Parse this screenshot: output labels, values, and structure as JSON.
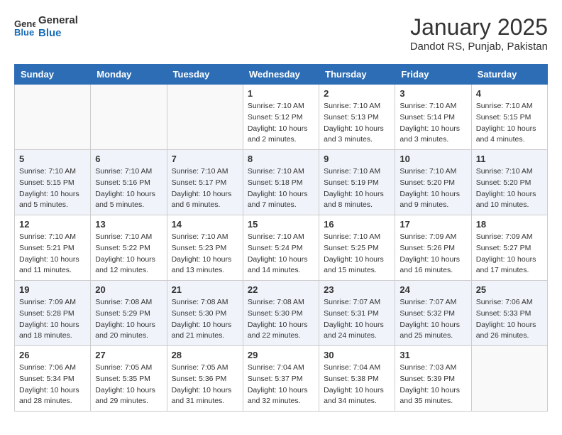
{
  "header": {
    "logo_line1": "General",
    "logo_line2": "Blue",
    "month_title": "January 2025",
    "subtitle": "Dandot RS, Punjab, Pakistan"
  },
  "weekdays": [
    "Sunday",
    "Monday",
    "Tuesday",
    "Wednesday",
    "Thursday",
    "Friday",
    "Saturday"
  ],
  "weeks": [
    [
      {
        "day": "",
        "sunrise": "",
        "sunset": "",
        "daylight": ""
      },
      {
        "day": "",
        "sunrise": "",
        "sunset": "",
        "daylight": ""
      },
      {
        "day": "",
        "sunrise": "",
        "sunset": "",
        "daylight": ""
      },
      {
        "day": "1",
        "sunrise": "Sunrise: 7:10 AM",
        "sunset": "Sunset: 5:12 PM",
        "daylight": "Daylight: 10 hours and 2 minutes."
      },
      {
        "day": "2",
        "sunrise": "Sunrise: 7:10 AM",
        "sunset": "Sunset: 5:13 PM",
        "daylight": "Daylight: 10 hours and 3 minutes."
      },
      {
        "day": "3",
        "sunrise": "Sunrise: 7:10 AM",
        "sunset": "Sunset: 5:14 PM",
        "daylight": "Daylight: 10 hours and 3 minutes."
      },
      {
        "day": "4",
        "sunrise": "Sunrise: 7:10 AM",
        "sunset": "Sunset: 5:15 PM",
        "daylight": "Daylight: 10 hours and 4 minutes."
      }
    ],
    [
      {
        "day": "5",
        "sunrise": "Sunrise: 7:10 AM",
        "sunset": "Sunset: 5:15 PM",
        "daylight": "Daylight: 10 hours and 5 minutes."
      },
      {
        "day": "6",
        "sunrise": "Sunrise: 7:10 AM",
        "sunset": "Sunset: 5:16 PM",
        "daylight": "Daylight: 10 hours and 5 minutes."
      },
      {
        "day": "7",
        "sunrise": "Sunrise: 7:10 AM",
        "sunset": "Sunset: 5:17 PM",
        "daylight": "Daylight: 10 hours and 6 minutes."
      },
      {
        "day": "8",
        "sunrise": "Sunrise: 7:10 AM",
        "sunset": "Sunset: 5:18 PM",
        "daylight": "Daylight: 10 hours and 7 minutes."
      },
      {
        "day": "9",
        "sunrise": "Sunrise: 7:10 AM",
        "sunset": "Sunset: 5:19 PM",
        "daylight": "Daylight: 10 hours and 8 minutes."
      },
      {
        "day": "10",
        "sunrise": "Sunrise: 7:10 AM",
        "sunset": "Sunset: 5:20 PM",
        "daylight": "Daylight: 10 hours and 9 minutes."
      },
      {
        "day": "11",
        "sunrise": "Sunrise: 7:10 AM",
        "sunset": "Sunset: 5:20 PM",
        "daylight": "Daylight: 10 hours and 10 minutes."
      }
    ],
    [
      {
        "day": "12",
        "sunrise": "Sunrise: 7:10 AM",
        "sunset": "Sunset: 5:21 PM",
        "daylight": "Daylight: 10 hours and 11 minutes."
      },
      {
        "day": "13",
        "sunrise": "Sunrise: 7:10 AM",
        "sunset": "Sunset: 5:22 PM",
        "daylight": "Daylight: 10 hours and 12 minutes."
      },
      {
        "day": "14",
        "sunrise": "Sunrise: 7:10 AM",
        "sunset": "Sunset: 5:23 PM",
        "daylight": "Daylight: 10 hours and 13 minutes."
      },
      {
        "day": "15",
        "sunrise": "Sunrise: 7:10 AM",
        "sunset": "Sunset: 5:24 PM",
        "daylight": "Daylight: 10 hours and 14 minutes."
      },
      {
        "day": "16",
        "sunrise": "Sunrise: 7:10 AM",
        "sunset": "Sunset: 5:25 PM",
        "daylight": "Daylight: 10 hours and 15 minutes."
      },
      {
        "day": "17",
        "sunrise": "Sunrise: 7:09 AM",
        "sunset": "Sunset: 5:26 PM",
        "daylight": "Daylight: 10 hours and 16 minutes."
      },
      {
        "day": "18",
        "sunrise": "Sunrise: 7:09 AM",
        "sunset": "Sunset: 5:27 PM",
        "daylight": "Daylight: 10 hours and 17 minutes."
      }
    ],
    [
      {
        "day": "19",
        "sunrise": "Sunrise: 7:09 AM",
        "sunset": "Sunset: 5:28 PM",
        "daylight": "Daylight: 10 hours and 18 minutes."
      },
      {
        "day": "20",
        "sunrise": "Sunrise: 7:08 AM",
        "sunset": "Sunset: 5:29 PM",
        "daylight": "Daylight: 10 hours and 20 minutes."
      },
      {
        "day": "21",
        "sunrise": "Sunrise: 7:08 AM",
        "sunset": "Sunset: 5:30 PM",
        "daylight": "Daylight: 10 hours and 21 minutes."
      },
      {
        "day": "22",
        "sunrise": "Sunrise: 7:08 AM",
        "sunset": "Sunset: 5:30 PM",
        "daylight": "Daylight: 10 hours and 22 minutes."
      },
      {
        "day": "23",
        "sunrise": "Sunrise: 7:07 AM",
        "sunset": "Sunset: 5:31 PM",
        "daylight": "Daylight: 10 hours and 24 minutes."
      },
      {
        "day": "24",
        "sunrise": "Sunrise: 7:07 AM",
        "sunset": "Sunset: 5:32 PM",
        "daylight": "Daylight: 10 hours and 25 minutes."
      },
      {
        "day": "25",
        "sunrise": "Sunrise: 7:06 AM",
        "sunset": "Sunset: 5:33 PM",
        "daylight": "Daylight: 10 hours and 26 minutes."
      }
    ],
    [
      {
        "day": "26",
        "sunrise": "Sunrise: 7:06 AM",
        "sunset": "Sunset: 5:34 PM",
        "daylight": "Daylight: 10 hours and 28 minutes."
      },
      {
        "day": "27",
        "sunrise": "Sunrise: 7:05 AM",
        "sunset": "Sunset: 5:35 PM",
        "daylight": "Daylight: 10 hours and 29 minutes."
      },
      {
        "day": "28",
        "sunrise": "Sunrise: 7:05 AM",
        "sunset": "Sunset: 5:36 PM",
        "daylight": "Daylight: 10 hours and 31 minutes."
      },
      {
        "day": "29",
        "sunrise": "Sunrise: 7:04 AM",
        "sunset": "Sunset: 5:37 PM",
        "daylight": "Daylight: 10 hours and 32 minutes."
      },
      {
        "day": "30",
        "sunrise": "Sunrise: 7:04 AM",
        "sunset": "Sunset: 5:38 PM",
        "daylight": "Daylight: 10 hours and 34 minutes."
      },
      {
        "day": "31",
        "sunrise": "Sunrise: 7:03 AM",
        "sunset": "Sunset: 5:39 PM",
        "daylight": "Daylight: 10 hours and 35 minutes."
      },
      {
        "day": "",
        "sunrise": "",
        "sunset": "",
        "daylight": ""
      }
    ]
  ]
}
